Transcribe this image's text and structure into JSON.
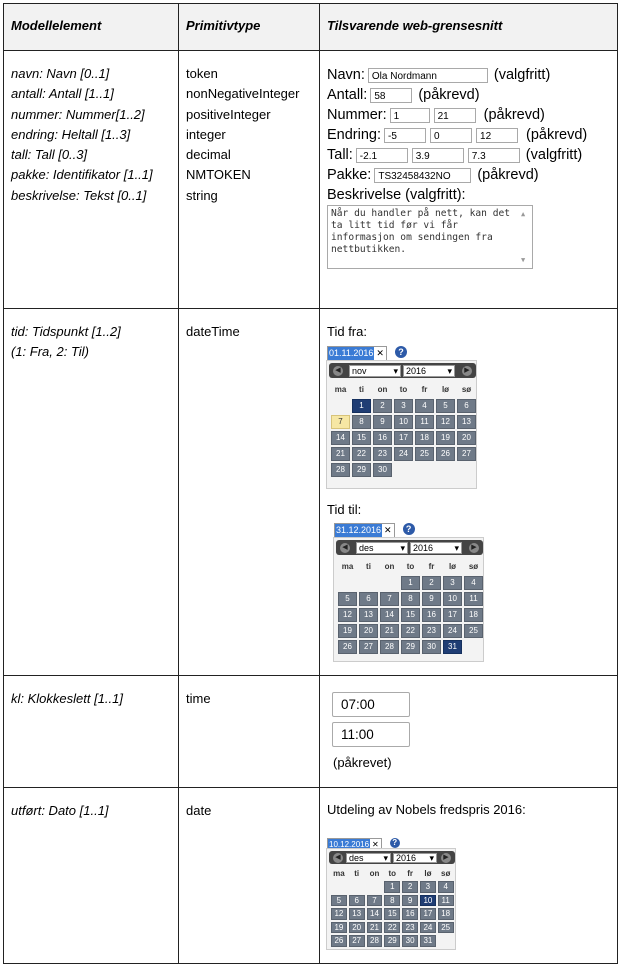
{
  "headers": [
    "Modellelement",
    "Primitivtype",
    "Tilsvarende web-grensesnitt"
  ],
  "row1": {
    "model": [
      "navn: Navn [0..1]",
      "antall: Antall [1..1]",
      "nummer: Nummer[1..2]",
      "endring: Heltall [1..3]",
      "tall: Tall [0..3]",
      "pakke: Identifikator [1..1]",
      "beskrivelse: Tekst [0..1]"
    ],
    "types": [
      "token",
      "nonNegativeInteger",
      "positiveInteger",
      "integer",
      "decimal",
      "NMTOKEN",
      "string"
    ],
    "form": {
      "navn_label": "Navn:",
      "navn_value": "Ola Nordmann",
      "navn_note": "(valgfritt)",
      "antall_label": "Antall:",
      "antall_value": "58",
      "antall_note": "(påkrevd)",
      "nummer_label": "Nummer:",
      "nummer_values": [
        "1",
        "21"
      ],
      "nummer_note": "(påkrevd)",
      "endring_label": "Endring:",
      "endring_values": [
        "-5",
        "0",
        "12"
      ],
      "endring_note": "(påkrevd)",
      "tall_label": "Tall:",
      "tall_values": [
        "-2.1",
        "3.9",
        "7.3"
      ],
      "tall_note": "(valgfritt)",
      "pakke_label": "Pakke:",
      "pakke_value": "TS32458432NO",
      "pakke_note": "(påkrevd)",
      "beskrivelse_label": "Beskrivelse (valgfritt):",
      "beskrivelse_text": "Når du handler på nett, kan det ta litt tid før vi får informasjon om sendingen fra nettbutikken."
    }
  },
  "row2": {
    "model": [
      "tid: Tidspunkt [1..2]",
      "(1: Fra, 2: Til)"
    ],
    "type": "dateTime",
    "weekdays": [
      "ma",
      "ti",
      "on",
      "to",
      "fr",
      "lø",
      "sø"
    ],
    "from": {
      "label": "Tid fra:",
      "value": "01.11.2016",
      "month": "nov",
      "year": "2016",
      "weeks": [
        [
          "",
          "1",
          "2",
          "3",
          "4",
          "5",
          "6"
        ],
        [
          "7",
          "8",
          "9",
          "10",
          "11",
          "12",
          "13"
        ],
        [
          "14",
          "15",
          "16",
          "17",
          "18",
          "19",
          "20"
        ],
        [
          "21",
          "22",
          "23",
          "24",
          "25",
          "26",
          "27"
        ],
        [
          "28",
          "29",
          "30",
          "",
          "",
          "",
          ""
        ]
      ],
      "selected": "1",
      "today": "7"
    },
    "to": {
      "label": "Tid til:",
      "value": "31.12.2016",
      "month": "des",
      "year": "2016",
      "weeks": [
        [
          "",
          "",
          "",
          "1",
          "2",
          "3",
          "4"
        ],
        [
          "5",
          "6",
          "7",
          "8",
          "9",
          "10",
          "11"
        ],
        [
          "12",
          "13",
          "14",
          "15",
          "16",
          "17",
          "18"
        ],
        [
          "19",
          "20",
          "21",
          "22",
          "23",
          "24",
          "25"
        ],
        [
          "26",
          "27",
          "28",
          "29",
          "30",
          "31",
          ""
        ]
      ],
      "selected": "31"
    }
  },
  "row3": {
    "model": "kl: Klokkeslett [1..1]",
    "type": "time",
    "times": [
      "07:00",
      "11:00"
    ],
    "note": "(påkrevet)"
  },
  "row4": {
    "model": "utført: Dato [1..1]",
    "type": "date",
    "caption": "Utdeling av Nobels fredspris 2016:",
    "cal": {
      "value": "10.12.2016",
      "month": "des",
      "year": "2016",
      "weeks": [
        [
          "",
          "",
          "",
          "1",
          "2",
          "3",
          "4"
        ],
        [
          "5",
          "6",
          "7",
          "8",
          "9",
          "10",
          "11"
        ],
        [
          "12",
          "13",
          "14",
          "15",
          "16",
          "17",
          "18"
        ],
        [
          "19",
          "20",
          "21",
          "22",
          "23",
          "24",
          "25"
        ],
        [
          "26",
          "27",
          "28",
          "29",
          "30",
          "31",
          ""
        ]
      ],
      "selected": "10"
    }
  }
}
